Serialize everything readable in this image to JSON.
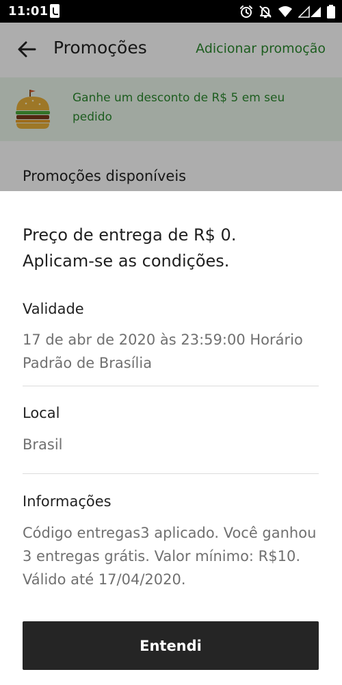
{
  "status_bar": {
    "time": "11:01",
    "icons": [
      "notification-icon",
      "alarm-icon",
      "muted-bell-icon",
      "wifi-icon",
      "signal-icon",
      "battery-icon"
    ]
  },
  "background_screen": {
    "title": "Promoções",
    "add_promotion_label": "Adicionar promoção",
    "banner": {
      "icon": "burger-icon",
      "text": "Ganhe um desconto de R$ 5 em seu pedido"
    },
    "section_heading": "Promoções disponíveis"
  },
  "sheet": {
    "title": "Preço de entrega de R$ 0.\nAplicam-se as condições.",
    "validity": {
      "label": "Validade",
      "value": "17 de abr de 2020 às 23:59:00 Horário Padrão de Brasília"
    },
    "location": {
      "label": "Local",
      "value": "Brasil"
    },
    "info": {
      "label": "Informações",
      "value": "Código entregas3 aplicado. Você ganhou 3 entregas grátis. Valor mínimo: R$10. Válido até 17/04/2020."
    },
    "button_label": "Entendi"
  },
  "colors": {
    "accent_green": "#2b8a2f",
    "banner_background": "#eaf6ea",
    "button_background": "#252525",
    "muted_text": "#707070"
  }
}
